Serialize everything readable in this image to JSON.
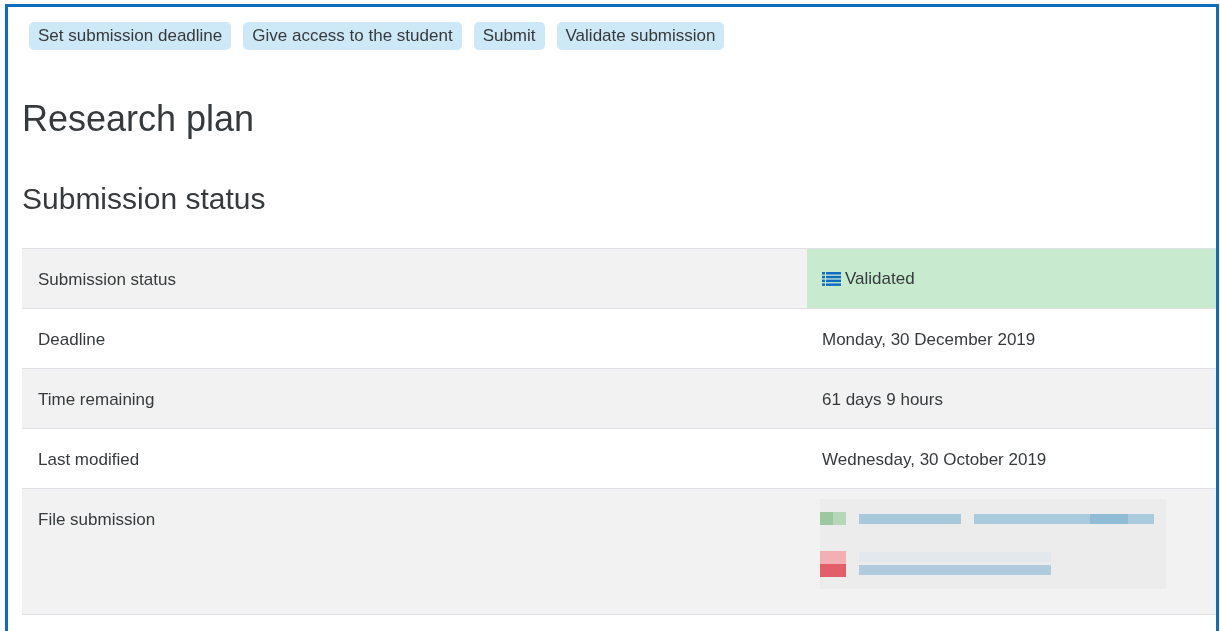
{
  "actions": [
    {
      "label": "Set submission deadline"
    },
    {
      "label": "Give access to the student"
    },
    {
      "label": "Submit"
    },
    {
      "label": "Validate submission"
    }
  ],
  "title": "Research plan",
  "section_title": "Submission status",
  "status_table": {
    "rows": [
      {
        "kind": "status",
        "label": "Submission status",
        "value": "Validated"
      },
      {
        "kind": "text",
        "label": "Deadline",
        "value": "Monday, 30 December 2019"
      },
      {
        "kind": "text",
        "label": "Time remaining",
        "value": "61 days 9 hours"
      },
      {
        "kind": "text",
        "label": "Last modified",
        "value": "Wednesday, 30 October 2019"
      },
      {
        "kind": "files",
        "label": "File submission"
      }
    ]
  }
}
